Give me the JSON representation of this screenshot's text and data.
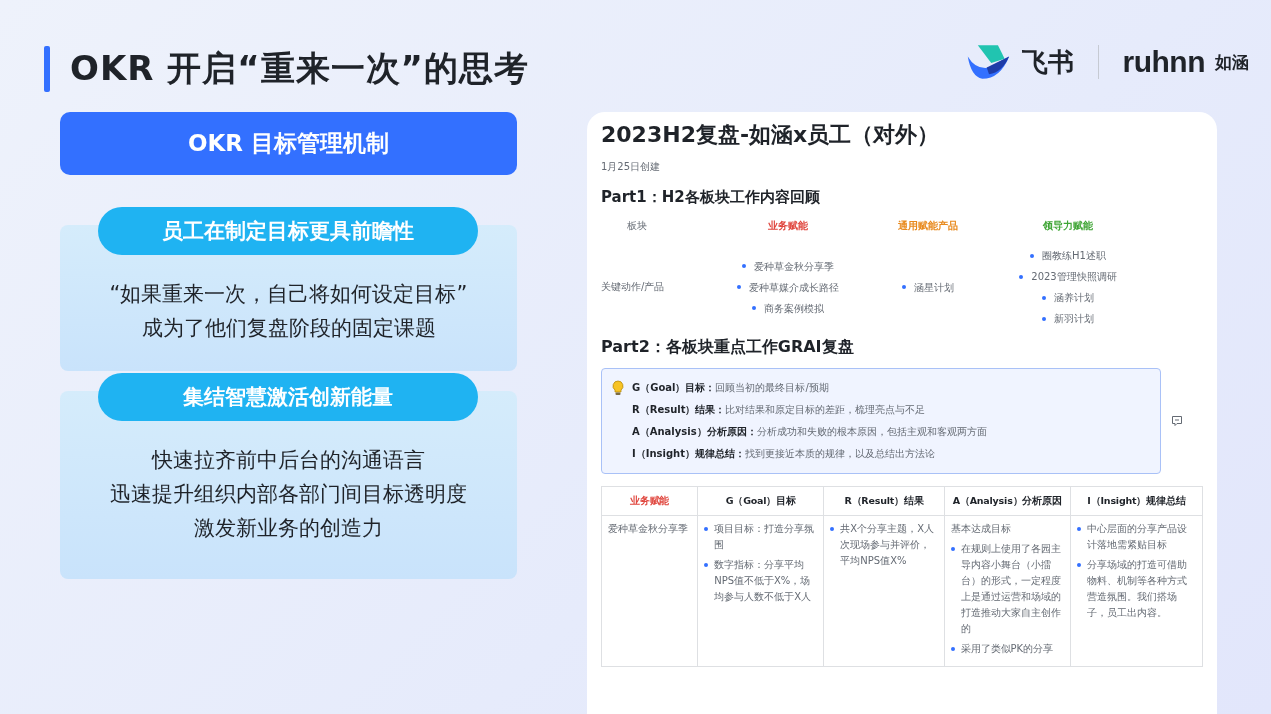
{
  "slide": {
    "title": "OKR 开启“重来一次”的思考"
  },
  "logos": {
    "feishu": "飞书",
    "ruhnn": "ruhnn",
    "ruhnn_cn": "如涵"
  },
  "left": {
    "banner": "OKR 目标管理机制",
    "cards": [
      {
        "heading": "员工在制定目标更具前瞻性",
        "lines": [
          "“如果重来一次，自己将如何设定目标”",
          "成为了他们复盘阶段的固定课题"
        ]
      },
      {
        "heading": "集结智慧激活创新能量",
        "lines": [
          "快速拉齐前中后台的沟通语言",
          "迅速提升组织内部各部门间目标透明度",
          "激发新业务的创造力"
        ]
      }
    ]
  },
  "document": {
    "title": "2023H2复盘-如涵x员工（对外）",
    "created": "1月25日创建",
    "part1": {
      "heading": "Part1：H2各板块工作内容回顾",
      "row_labels": [
        "板块",
        "关键动作/产品"
      ],
      "columns": [
        {
          "name": "业务赋能",
          "color": "#e0463e",
          "items": [
            "爱种草金秋分享季",
            "爱种草媒介成长路径",
            "商务案例模拟"
          ]
        },
        {
          "name": "通用赋能产品",
          "color": "#e8891c",
          "items": [
            "涵星计划"
          ]
        },
        {
          "name": "领导力赋能",
          "color": "#3fa535",
          "items": [
            "圈教练H1述职",
            "2023管理快照调研",
            "涵养计划",
            "新羽计划"
          ]
        }
      ]
    },
    "part2": {
      "heading": "Part2：各板块重点工作GRAI复盘",
      "callout": [
        {
          "term": "G（Goal）目标：",
          "text": "回顾当初的最终目标/预期"
        },
        {
          "term": "R（Result）结果：",
          "text": "比对结果和原定目标的差距，梳理亮点与不足"
        },
        {
          "term": "A（Analysis）分析原因：",
          "text": "分析成功和失败的根本原因，包括主观和客观两方面"
        },
        {
          "term": "I（Insight）规律总结：",
          "text": "找到更接近本质的规律，以及总结出方法论"
        }
      ],
      "table": {
        "columns": [
          {
            "label": "业务赋能",
            "color": "#e0463e"
          },
          {
            "label": "G（Goal）目标",
            "color": "#1f2329"
          },
          {
            "label": "R（Result）结果",
            "color": "#1f2329"
          },
          {
            "label": "A（Analysis）分析原因",
            "color": "#1f2329"
          },
          {
            "label": "I（Insight）规律总结",
            "color": "#1f2329"
          }
        ],
        "rows": [
          [
            {
              "text": "爱种草金秋分享季"
            },
            {
              "bullets": [
                "项目目标：打造分享氛围",
                "数字指标：分享平均NPS值不低于X%，场均参与人数不低于X人"
              ]
            },
            {
              "bullets": [
                "共X个分享主题，X人次现场参与并评价，平均NPS值X%"
              ]
            },
            {
              "text": "基本达成目标",
              "bullets": [
                "在规则上使用了各园主导内容小舞台（小擂台）的形式，一定程度上是通过运营和场域的打造推动大家自主创作的",
                "采用了类似PK的分享"
              ]
            },
            {
              "bullets": [
                "中心层面的分享产品设计落地需紧贴目标",
                "分享场域的打造可借助物料、机制等各种方式营造氛围。我们搭场子，员工出内容。"
              ]
            }
          ]
        ]
      }
    }
  }
}
